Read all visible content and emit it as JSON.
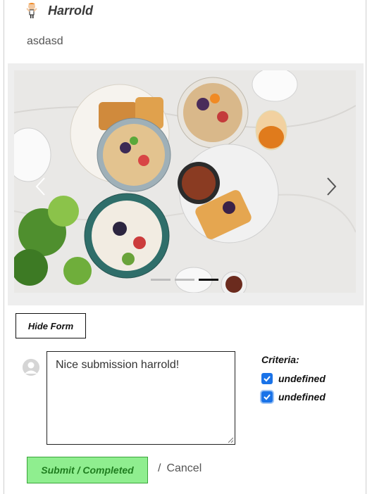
{
  "post": {
    "user_name": "Harrold",
    "text": "asdasd"
  },
  "carousel": {
    "image_subject": "breakfast spread: smoothie bowls, waffles, berries, coffee on marble table",
    "slide_count": 3,
    "active_slide": 3
  },
  "form": {
    "hide_button_label": "Hide Form",
    "comment_value": "Nice submission harrold!",
    "criteria_title": "Criteria:",
    "criteria": [
      {
        "label": "undefined",
        "checked": true
      },
      {
        "label": "undefined",
        "checked": true
      }
    ],
    "submit_label": "Submit / Completed",
    "separator": "/",
    "cancel_label": "Cancel"
  },
  "colors": {
    "checkbox": "#1a73e8",
    "submit_bg": "#8fee8f",
    "submit_text": "#1f7d1f"
  }
}
